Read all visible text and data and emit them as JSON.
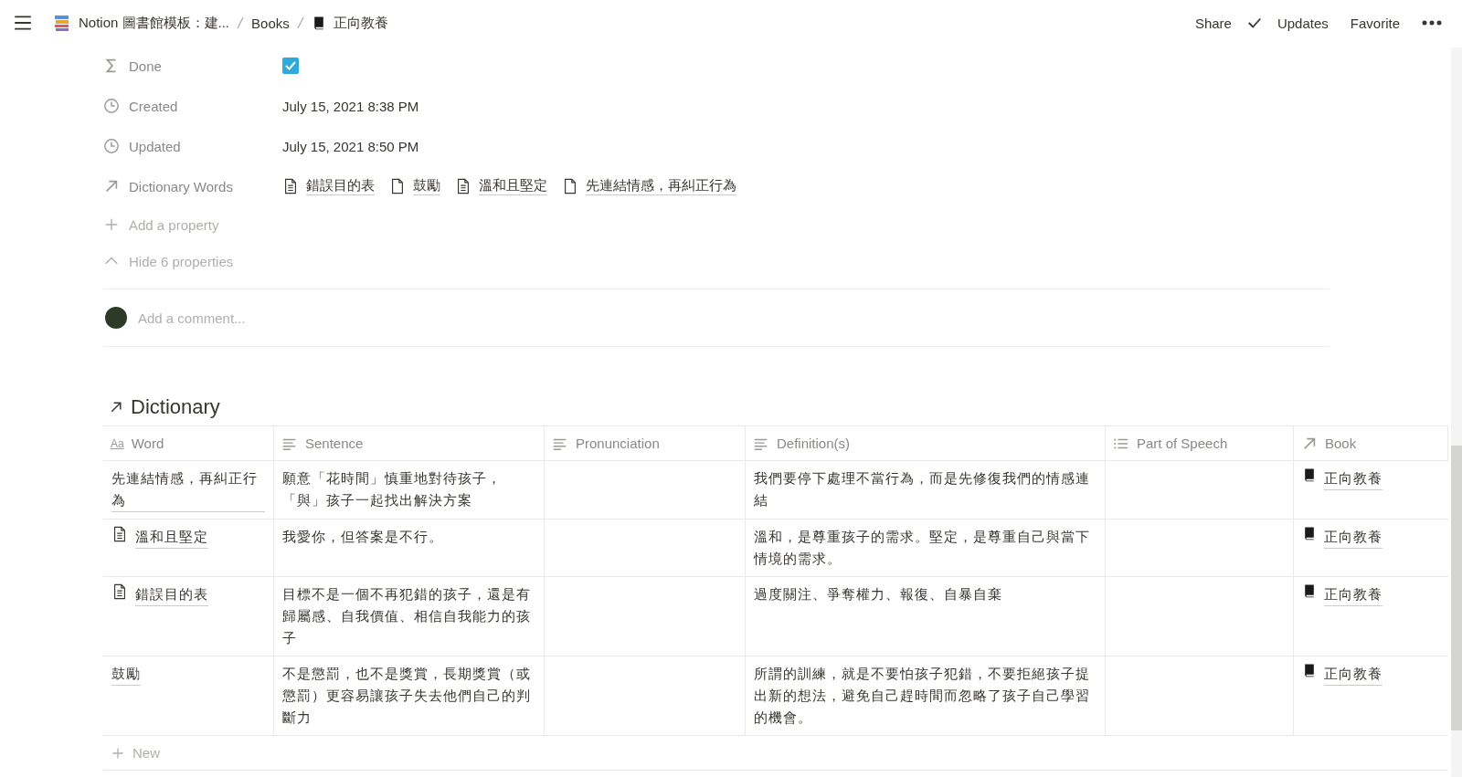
{
  "topbar": {
    "breadcrumbs": [
      {
        "label": "Notion 圖書館模板：建...",
        "kind": "books"
      },
      {
        "label": "Books",
        "kind": "plain"
      },
      {
        "label": "正向教養",
        "kind": "book"
      }
    ],
    "actions": [
      {
        "label": "Share",
        "kind": "plain"
      },
      {
        "label": "Updates",
        "kind": "check"
      },
      {
        "label": "Favorite",
        "kind": "plain"
      }
    ]
  },
  "properties": [
    {
      "kind": "checkbox",
      "label": "Done",
      "checked": true
    },
    {
      "kind": "date",
      "label": "Created",
      "value": "July 15, 2021 8:38 PM"
    },
    {
      "kind": "date",
      "label": "Updated",
      "value": "July 15, 2021 8:50 PM"
    },
    {
      "kind": "relation",
      "label": "Dictionary Words",
      "links": [
        {
          "label": "錯誤目的表",
          "kind": "text"
        },
        {
          "label": "鼓勵",
          "kind": "blank"
        },
        {
          "label": "溫和且堅定",
          "kind": "text"
        },
        {
          "label": "先連結情感，再糾正行為",
          "kind": "blank"
        }
      ]
    }
  ],
  "add_property": "Add a property",
  "hide_properties": "Hide 6 properties",
  "comment": {
    "placeholder": "Add a comment..."
  },
  "dictionary": {
    "title": "Dictionary",
    "columns": [
      {
        "label": "Word",
        "kind": "title",
        "glyph": "Aa"
      },
      {
        "label": "Sentence",
        "kind": "text"
      },
      {
        "label": "Pronunciation",
        "kind": "text"
      },
      {
        "label": "Definition(s)",
        "kind": "text"
      },
      {
        "label": "Part of Speech",
        "kind": "list"
      },
      {
        "label": "Book",
        "kind": "relation"
      }
    ],
    "rows": [
      {
        "word": "先連結情感，再糾正行為",
        "has_icon": false,
        "sentence": "願意「花時間」慎重地對待孩子，「與」孩子一起找出解決方案",
        "definition": "我們要停下處理不當行為，而是先修復我們的情感連結",
        "book": "正向教養"
      },
      {
        "word": "溫和且堅定",
        "has_icon": true,
        "sentence": "我愛你，但答案是不行。",
        "definition": "溫和，是尊重孩子的需求。堅定，是尊重自己與當下情境的需求。",
        "book": "正向教養"
      },
      {
        "word": "錯誤目的表",
        "has_icon": true,
        "sentence": "目標不是一個不再犯錯的孩子，還是有歸屬感、自我價值、相信自我能力的孩子",
        "definition": "過度關注、爭奪權力、報復、自暴自棄",
        "book": "正向教養"
      },
      {
        "word": "鼓勵",
        "has_icon": false,
        "sentence": "不是懲罰，也不是獎賞，長期獎賞（或懲罰）更容易讓孩子失去他們自己的判斷力",
        "definition": "所謂的訓練，就是不要怕孩子犯錯，不要拒絕孩子提出新的想法，避免自己趕時間而忽略了孩子自己學習的機會。",
        "book": "正向教養"
      }
    ],
    "new_label": "New"
  }
}
